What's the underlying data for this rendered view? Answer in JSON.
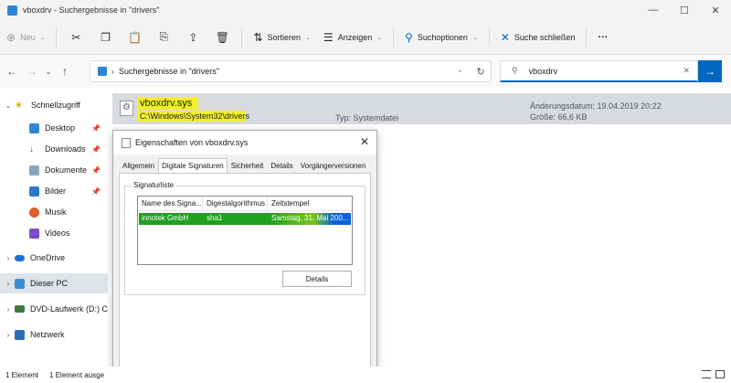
{
  "window": {
    "title": "vboxdrv - Suchergebnisse in \"drivers\"",
    "controls": [
      "—",
      "☐",
      "✕"
    ]
  },
  "toolbar": {
    "new_label": "Neu",
    "sort_label": "Sortieren",
    "view_label": "Anzeigen",
    "search_options_label": "Suchoptionen",
    "close_search_label": "Suche schließen",
    "more_label": "···"
  },
  "address": {
    "crumb": "Suchergebnisse in \"drivers\"",
    "search_value": "vboxdrv"
  },
  "sidebar": {
    "items": [
      {
        "label": "Schnellzugriff",
        "icon": "star-icon"
      },
      {
        "label": "Desktop",
        "icon": "desktop-icon",
        "pinned": true
      },
      {
        "label": "Downloads",
        "icon": "download-icon",
        "pinned": true
      },
      {
        "label": "Dokumente",
        "icon": "documents-icon",
        "pinned": true
      },
      {
        "label": "Bilder",
        "icon": "pictures-icon",
        "pinned": true
      },
      {
        "label": "Musik",
        "icon": "music-icon"
      },
      {
        "label": "Videos",
        "icon": "videos-icon"
      },
      {
        "label": "OneDrive",
        "icon": "cloud-icon"
      },
      {
        "label": "Dieser PC",
        "icon": "pc-icon"
      },
      {
        "label": "DVD-Laufwerk (D:) C",
        "icon": "dvd-icon"
      },
      {
        "label": "Netzwerk",
        "icon": "network-icon"
      }
    ]
  },
  "result": {
    "name": "vboxdrv.sys",
    "path": "C:\\Windows\\System32\\drivers",
    "type": "Typ: Systemdatei",
    "date": "Änderungsdatum: 19.04.2019 20:22",
    "size": "Größe: 66,6 KB"
  },
  "dialog": {
    "title": "Eigenschaften von vboxdrv.sys",
    "tabs": [
      "Allgemein",
      "Digitale Signaturen",
      "Sicherheit",
      "Details",
      "Vorgängerversionen"
    ],
    "group_label": "Signaturliste",
    "columns": [
      "Name des Signa...",
      "Digestalgorithmus",
      "Zeitstempel"
    ],
    "row": [
      "innotek GmbH",
      "sha1",
      "Samstag, 31. Mai 200..."
    ],
    "details_button": "Details"
  },
  "status": {
    "count": "1 Element",
    "selected": "1 Element ausge"
  },
  "colors": {
    "accent": "#0067c0",
    "highlight_yellow": "#f2ef2c",
    "highlight_green": "#1fa01f",
    "selection_blue": "#0a64d6"
  }
}
